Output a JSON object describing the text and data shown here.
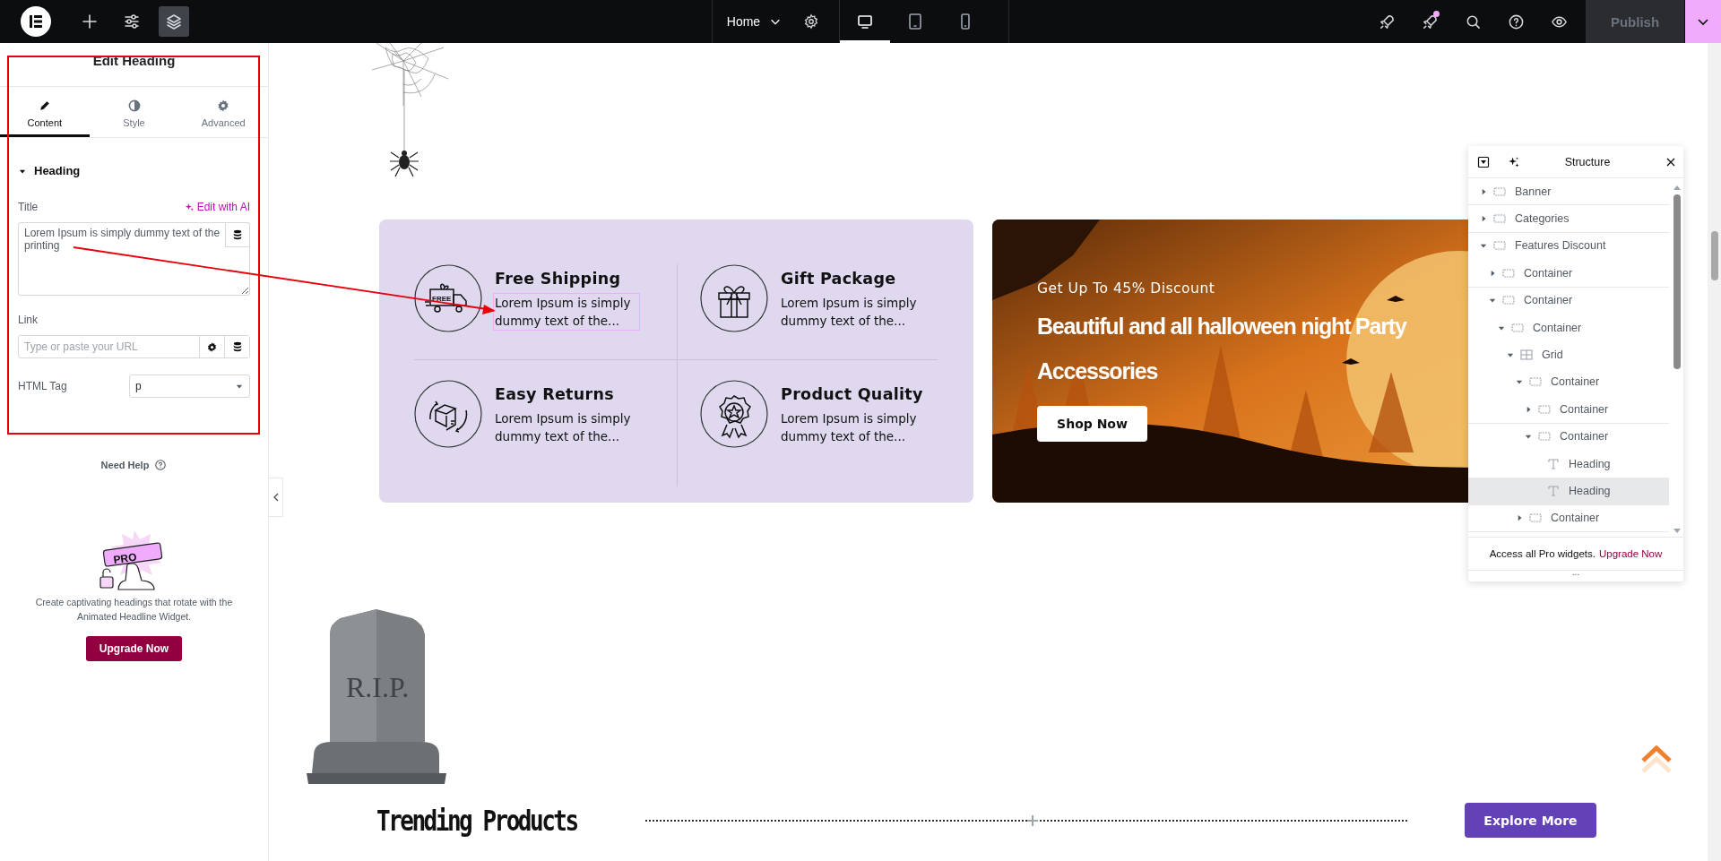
{
  "topbar": {
    "tools": [
      {
        "kind": "add",
        "selected": false
      },
      {
        "kind": "site-settings",
        "selected": false
      },
      {
        "kind": "structure",
        "selected": true
      }
    ],
    "page": "Home",
    "devices": [
      {
        "kind": "desktop",
        "selected": true
      },
      {
        "kind": "tablet",
        "selected": false
      },
      {
        "kind": "mobile",
        "selected": false
      }
    ],
    "actions": [
      {
        "kind": "launch",
        "notification": false
      },
      {
        "kind": "whats-new",
        "notification": true
      },
      {
        "kind": "search",
        "notification": false
      },
      {
        "kind": "help",
        "notification": false
      },
      {
        "kind": "preview",
        "notification": false
      }
    ],
    "publish": {
      "label": "Publish",
      "disabled": true
    }
  },
  "panel": {
    "title": "Edit Heading",
    "tabs": [
      {
        "kind": "content",
        "label": "Content",
        "selected": true
      },
      {
        "kind": "style",
        "label": "Style",
        "selected": false
      },
      {
        "kind": "advanced",
        "label": "Advanced",
        "selected": false
      }
    ],
    "section": {
      "label": "Heading",
      "expanded": true
    },
    "title_field": {
      "label": "Title",
      "ai_link": "Edit with AI",
      "value": "Lorem Ipsum is simply dummy text of the printing"
    },
    "link_field": {
      "label": "Link",
      "placeholder": "Type or paste your URL"
    },
    "html_tag": {
      "label": "HTML Tag",
      "value": "p"
    },
    "help": "Need Help",
    "promo": {
      "badge": "PRO",
      "text": "Create captivating headings that rotate with the Animated Headline Widget.",
      "button": "Upgrade Now"
    }
  },
  "annotations": {
    "highlight_frame": true,
    "arrow": true
  },
  "features": [
    {
      "kind": "shipping",
      "badge": "FREE",
      "title": "Free Shipping",
      "text": "Lorem Ipsum is simply dummy text of the...",
      "selected": true
    },
    {
      "kind": "gift",
      "title": "Gift Package",
      "text": "Lorem Ipsum is simply dummy text of the...",
      "selected": false
    },
    {
      "kind": "returns",
      "title": "Easy Returns",
      "text": "Lorem Ipsum is simply dummy text of the...",
      "selected": false
    },
    {
      "kind": "quality",
      "title": "Product Quality",
      "text": "Lorem Ipsum is simply dummy text of the...",
      "selected": false
    }
  ],
  "banner": {
    "eyebrow": "Get Up To 45% Discount",
    "title": "Beautiful and all halloween night Party Accessories",
    "button": "Shop Now"
  },
  "tombstone": {
    "inscription": "R.I.P."
  },
  "trending": {
    "title": "Trending Products",
    "button": "Explore More"
  },
  "structure": {
    "title": "Structure",
    "tree": [
      {
        "kind": "container",
        "label": "Banner",
        "expanded": false,
        "selected": false
      },
      {
        "kind": "container",
        "label": "Categories",
        "expanded": false,
        "selected": false
      },
      {
        "kind": "container",
        "label": "Features Discount",
        "expanded": true,
        "selected": false,
        "children": [
          {
            "kind": "container",
            "label": "Container",
            "expanded": false,
            "selected": false
          },
          {
            "kind": "container",
            "label": "Container",
            "expanded": true,
            "selected": false,
            "children": [
              {
                "kind": "container",
                "label": "Container",
                "expanded": true,
                "selected": false,
                "children": [
                  {
                    "kind": "grid",
                    "label": "Grid",
                    "expanded": true,
                    "selected": false,
                    "children": [
                      {
                        "kind": "container",
                        "label": "Container",
                        "expanded": true,
                        "selected": false,
                        "children": [
                          {
                            "kind": "container",
                            "label": "Container",
                            "expanded": false,
                            "selected": false
                          },
                          {
                            "kind": "container",
                            "label": "Container",
                            "expanded": true,
                            "selected": false,
                            "children": [
                              {
                                "kind": "heading",
                                "label": "Heading",
                                "selected": false
                              },
                              {
                                "kind": "heading",
                                "label": "Heading",
                                "selected": true
                              }
                            ]
                          }
                        ]
                      },
                      {
                        "kind": "container",
                        "label": "Container",
                        "expanded": false,
                        "selected": false
                      }
                    ]
                  }
                ]
              }
            ]
          }
        ]
      }
    ],
    "footer": {
      "text": "Access all Pro widgets.",
      "link": "Upgrade Now"
    },
    "handle": "..."
  }
}
